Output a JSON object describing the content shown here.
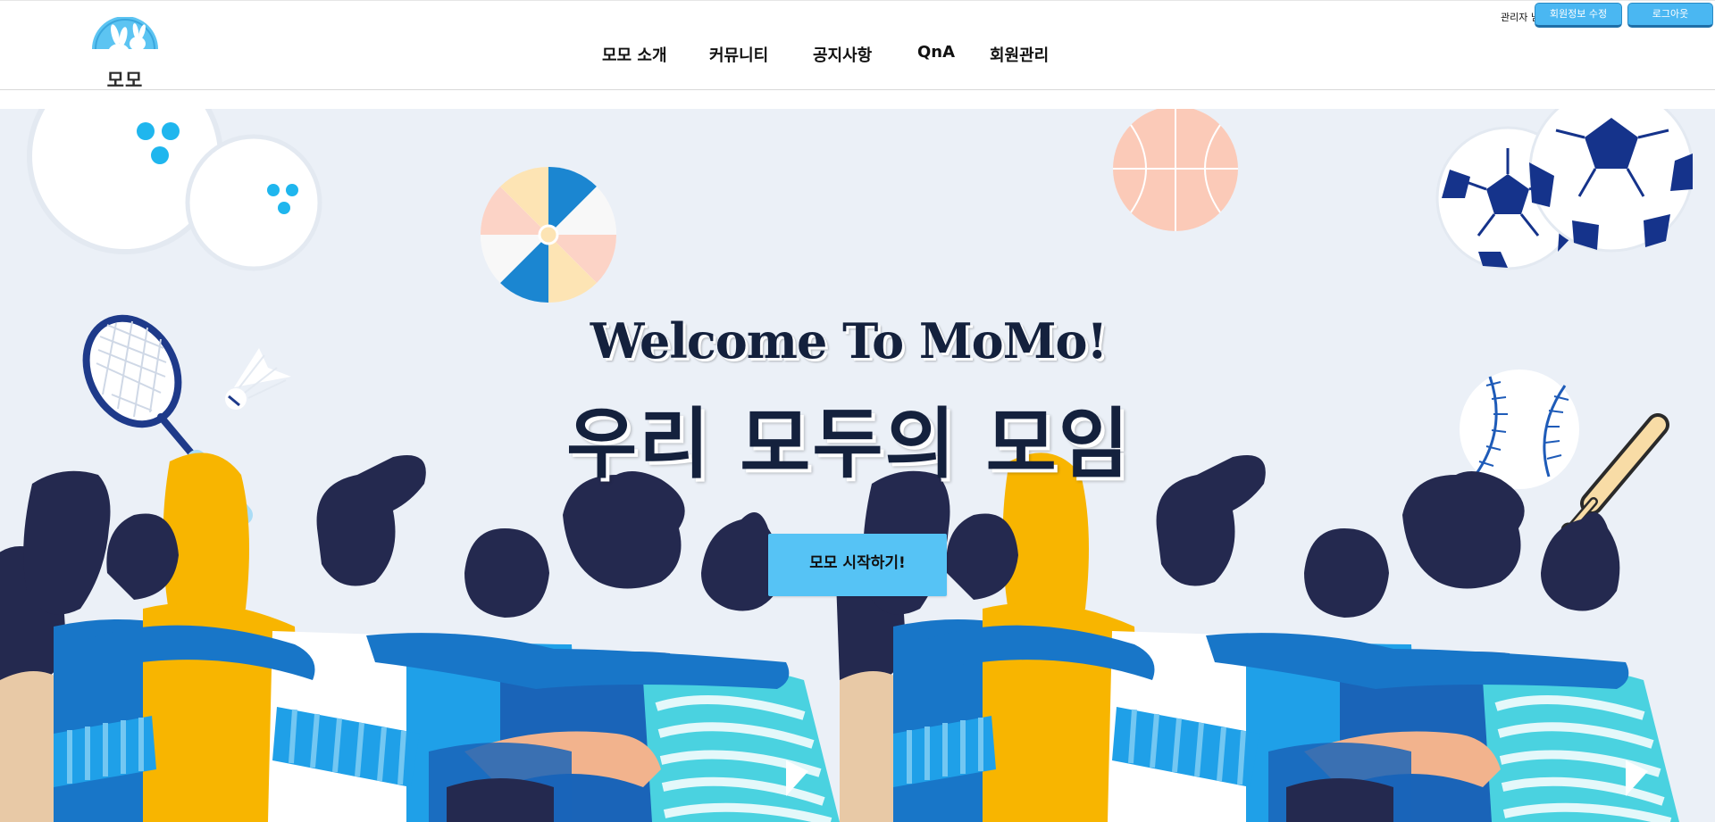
{
  "brand": {
    "logo_text": "모모"
  },
  "nav": {
    "items": [
      {
        "label": "모모 소개"
      },
      {
        "label": "커뮤니티"
      },
      {
        "label": "공지사항"
      },
      {
        "label": "QnA"
      },
      {
        "label": "회원관리"
      }
    ]
  },
  "user": {
    "greeting": "관리자 님",
    "edit_profile_label": "회원정보 수정",
    "logout_label": "로그아웃"
  },
  "hero": {
    "welcome": "Welcome To MoMo!",
    "subtitle": "우리 모두의 모임",
    "start_button_label": "모모 시작하기!"
  },
  "colors": {
    "accent": "#56c3f5",
    "hero_background": "#ebf0f7",
    "navy": "#14213d"
  },
  "icons": [
    "bunny-logo-icon",
    "bowling-ball-icon",
    "beach-ball-icon",
    "basketball-icon",
    "soccer-ball-icon",
    "tennis-racket-icon",
    "shuttlecock-icon",
    "baseball-icon",
    "baseball-bat-icon"
  ]
}
